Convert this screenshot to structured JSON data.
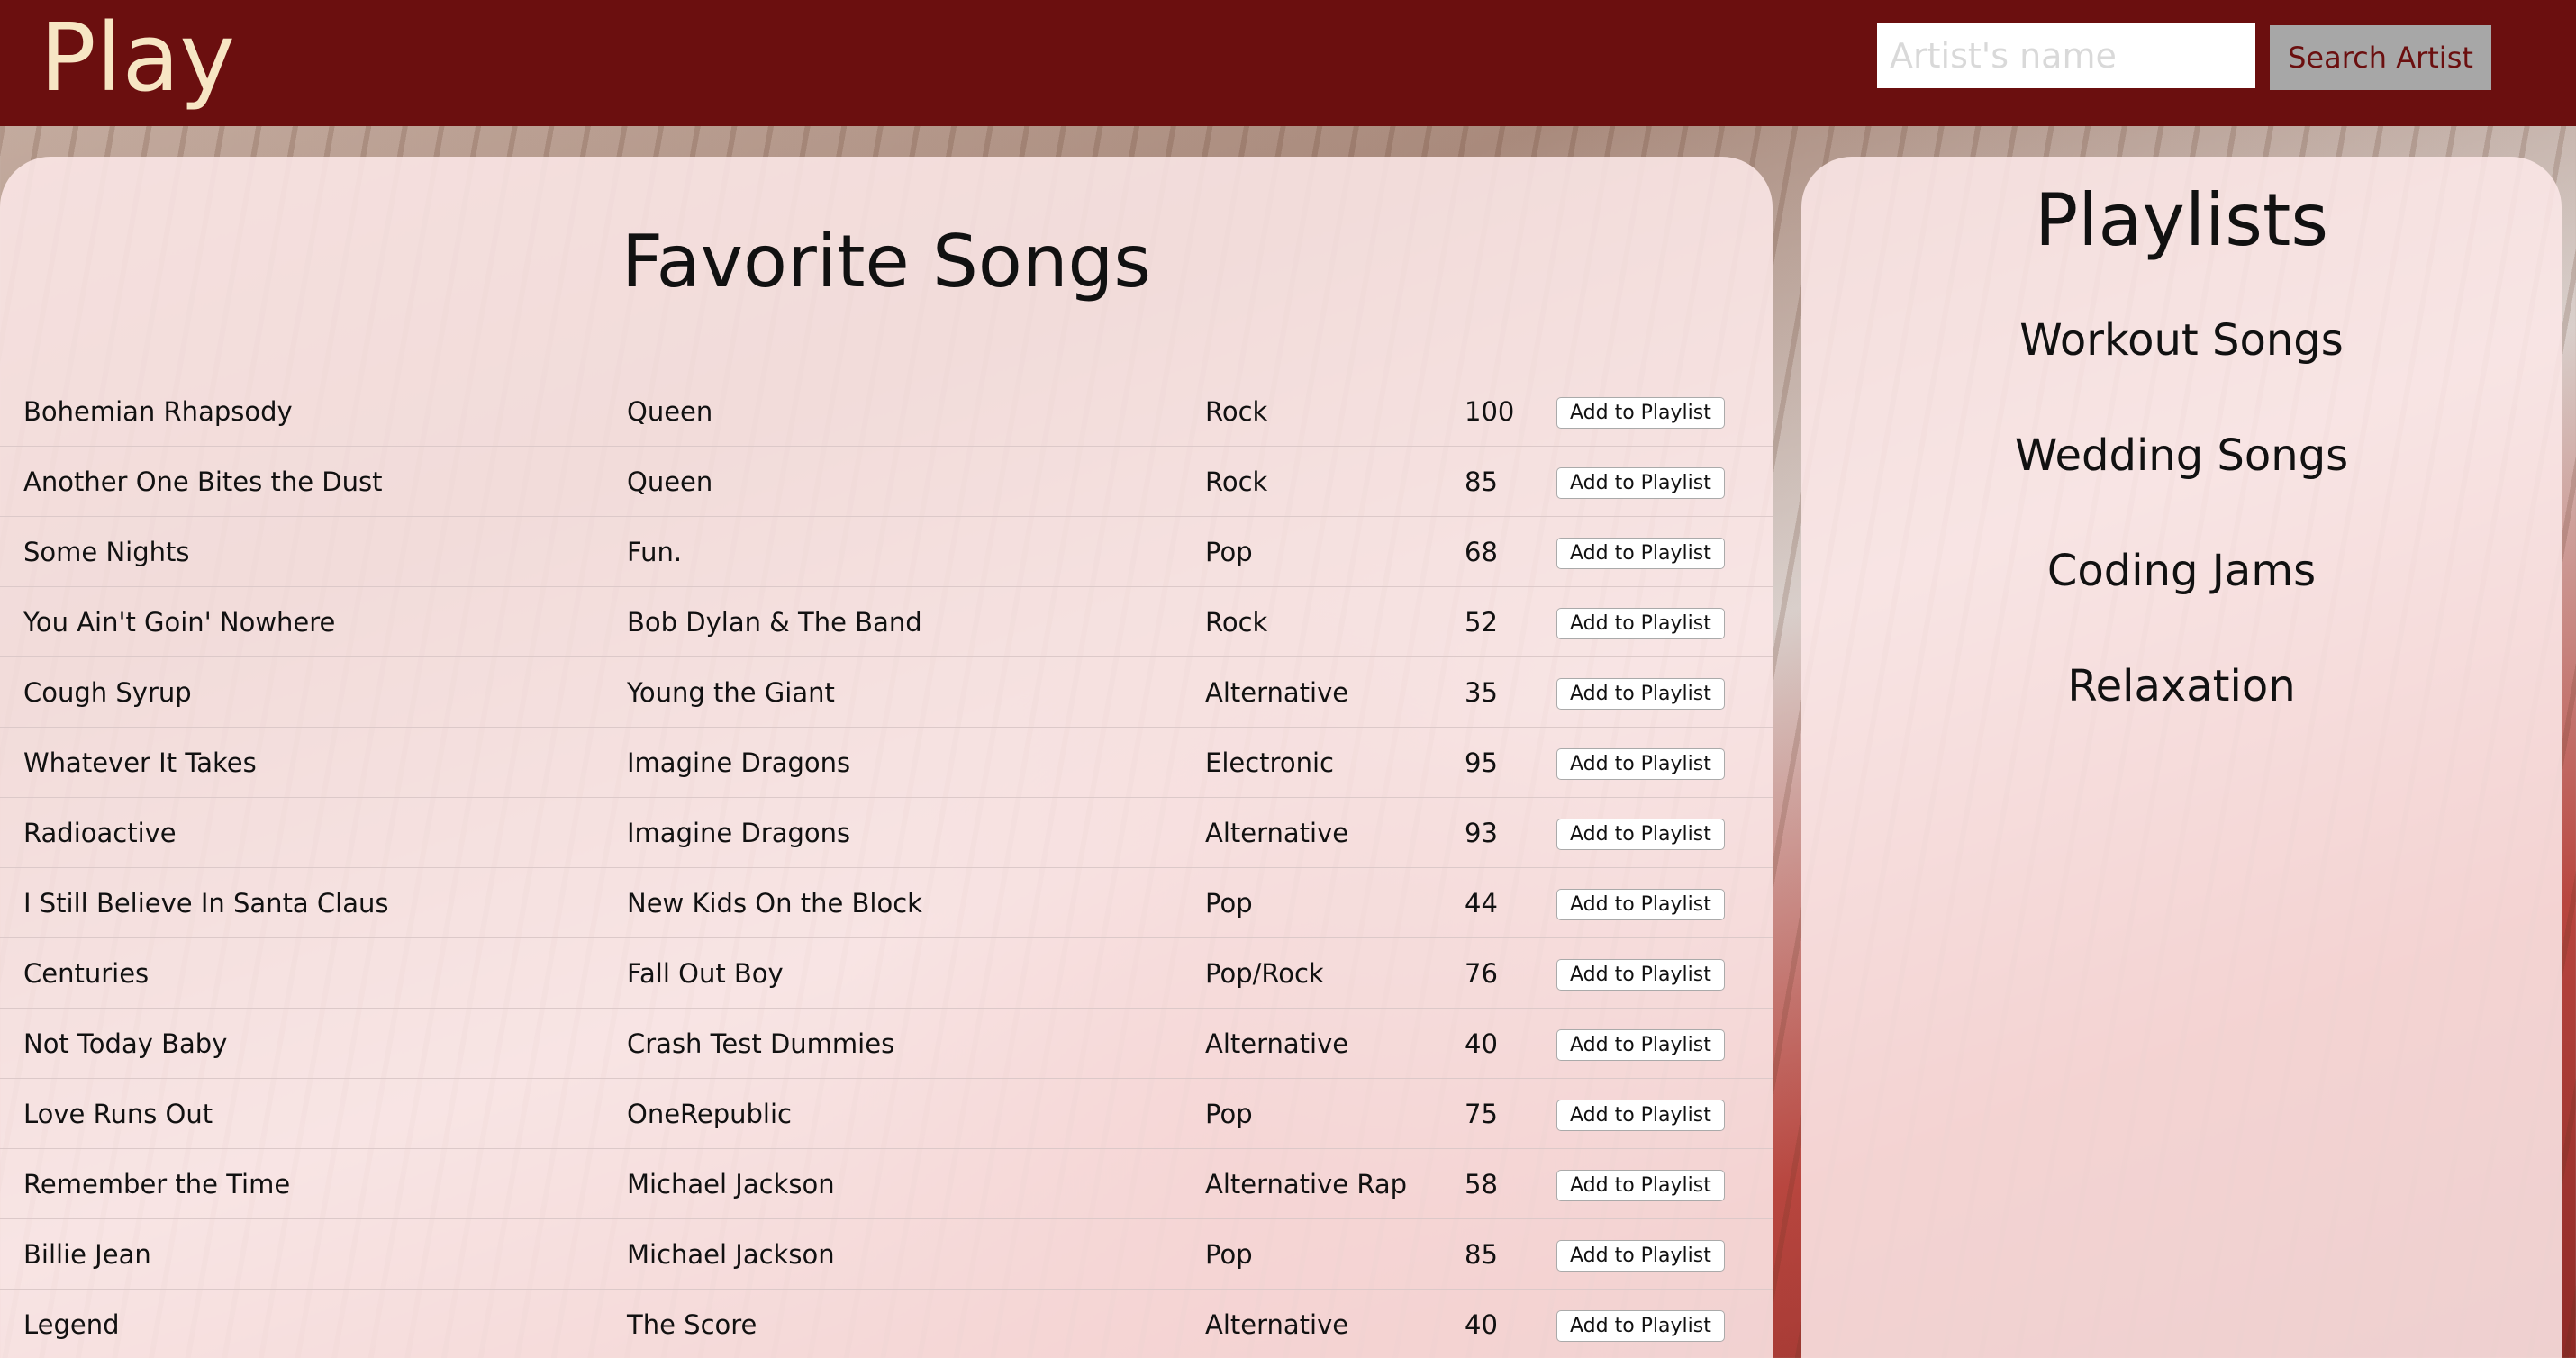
{
  "header": {
    "logo": "Play",
    "search_placeholder": "Artist's name",
    "search_button": "Search Artist"
  },
  "songs": {
    "title": "Favorite Songs",
    "add_label": "Add to Playlist",
    "rows": [
      {
        "title": "Bohemian Rhapsody",
        "artist": "Queen",
        "genre": "Rock",
        "popularity": "100"
      },
      {
        "title": "Another One Bites the Dust",
        "artist": "Queen",
        "genre": "Rock",
        "popularity": "85"
      },
      {
        "title": "Some Nights",
        "artist": "Fun.",
        "genre": "Pop",
        "popularity": "68"
      },
      {
        "title": "You Ain't Goin' Nowhere",
        "artist": "Bob Dylan & The Band",
        "genre": "Rock",
        "popularity": "52"
      },
      {
        "title": "Cough Syrup",
        "artist": "Young the Giant",
        "genre": "Alternative",
        "popularity": "35"
      },
      {
        "title": "Whatever It Takes",
        "artist": "Imagine Dragons",
        "genre": "Electronic",
        "popularity": "95"
      },
      {
        "title": "Radioactive",
        "artist": "Imagine Dragons",
        "genre": "Alternative",
        "popularity": "93"
      },
      {
        "title": "I Still Believe In Santa Claus",
        "artist": "New Kids On the Block",
        "genre": "Pop",
        "popularity": "44"
      },
      {
        "title": "Centuries",
        "artist": "Fall Out Boy",
        "genre": "Pop/Rock",
        "popularity": "76"
      },
      {
        "title": "Not Today Baby",
        "artist": "Crash Test Dummies",
        "genre": "Alternative",
        "popularity": "40"
      },
      {
        "title": "Love Runs Out",
        "artist": "OneRepublic",
        "genre": "Pop",
        "popularity": "75"
      },
      {
        "title": "Remember the Time",
        "artist": "Michael Jackson",
        "genre": "Alternative Rap",
        "popularity": "58"
      },
      {
        "title": "Billie Jean",
        "artist": "Michael Jackson",
        "genre": "Pop",
        "popularity": "85"
      },
      {
        "title": "Legend",
        "artist": "The Score",
        "genre": "Alternative",
        "popularity": "40"
      }
    ]
  },
  "playlists": {
    "title": "Playlists",
    "items": [
      "Workout Songs",
      "Wedding Songs",
      "Coding Jams",
      "Relaxation"
    ]
  }
}
